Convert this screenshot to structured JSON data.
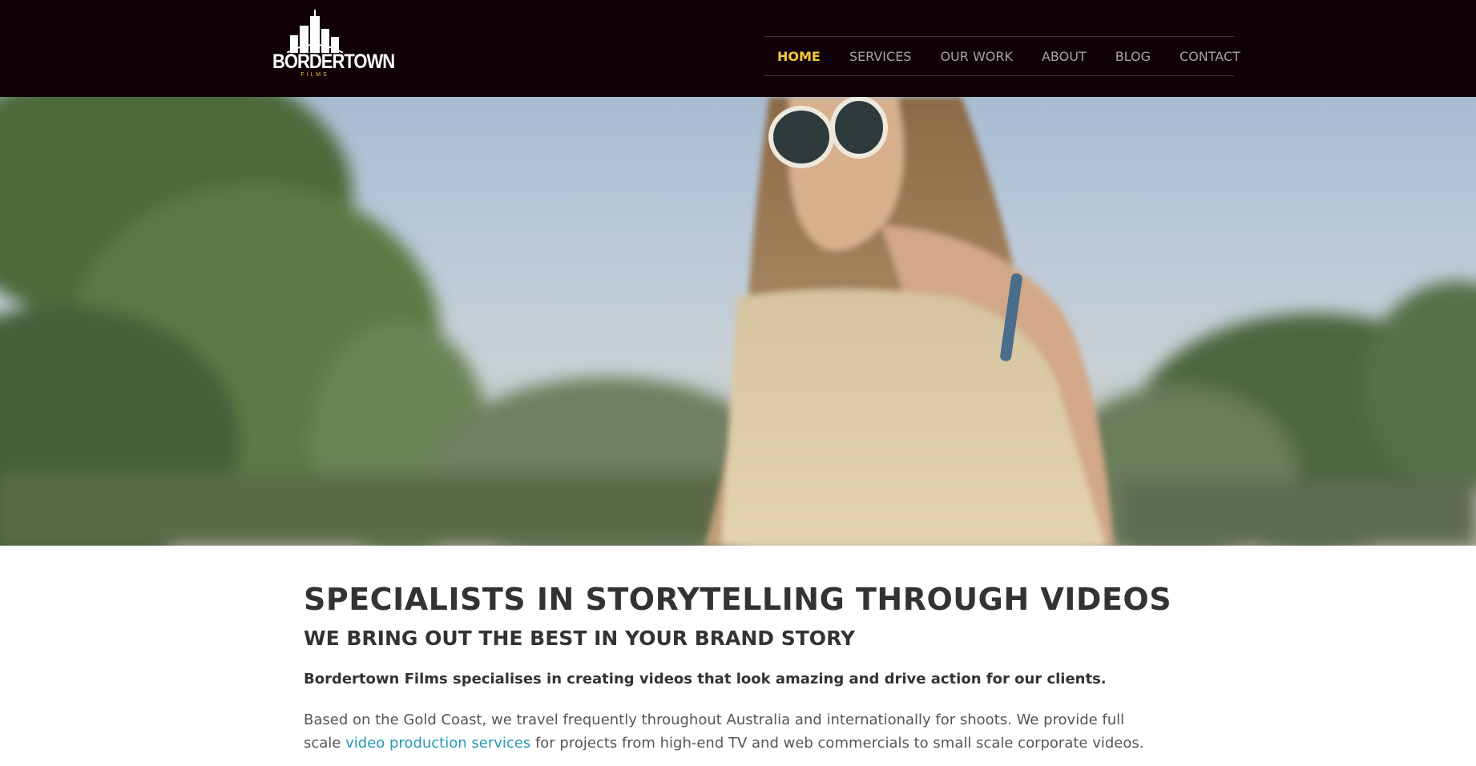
{
  "header": {
    "logo": {
      "brand": "BORDERTOWN",
      "tagline": "FILMS"
    },
    "nav": [
      {
        "label": "HOME",
        "active": true
      },
      {
        "label": "SERVICES",
        "active": false
      },
      {
        "label": "OUR WORK",
        "active": false
      },
      {
        "label": "ABOUT",
        "active": false
      },
      {
        "label": "BLOG",
        "active": false
      },
      {
        "label": "CONTACT",
        "active": false
      }
    ]
  },
  "main": {
    "headline": "SPECIALISTS IN STORYTELLING THROUGH VIDEOS",
    "subheadline": "WE BRING OUT THE BEST IN YOUR BRAND STORY",
    "intro_bold": "Bordertown Films specialises in creating videos that look amazing and drive action for our clients.",
    "intro_before_link": "Based on the Gold Coast, we travel frequently throughout Australia and internationally for shoots. We provide full scale ",
    "intro_link": "video production services",
    "intro_after_link": " for projects from high-end TV and web commercials to small scale corporate videos."
  },
  "colors": {
    "header_bg": "#100207",
    "nav_active": "#f3c840",
    "nav_inactive": "#a6a2a4",
    "link": "#2598b8",
    "text": "#333333"
  }
}
